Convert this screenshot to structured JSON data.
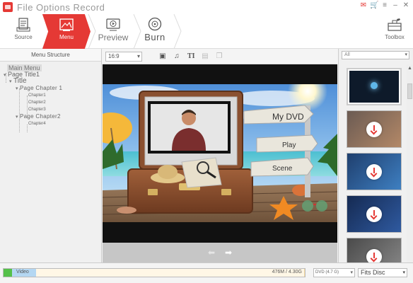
{
  "window": {
    "title": "File Options Record"
  },
  "steps": {
    "source": "Source",
    "menu": "Menu",
    "preview": "Preview",
    "burn": "Burn",
    "toolbox": "Toolbox"
  },
  "menu_structure": {
    "header": "Menu Structure",
    "tree": {
      "main_menu": "Main Menu",
      "page_title": "Page Title1",
      "title": "Title",
      "chapter_page1": "Page Chapter 1",
      "chapters1": [
        "Chapter1",
        "Chapter2",
        "Chapter3"
      ],
      "chapter_page2": "Page Chapter2",
      "chapters2": [
        "Chapter4"
      ]
    }
  },
  "center": {
    "aspect_ratio": "16:9",
    "preview_menu": {
      "title": "My DVD",
      "play": "Play",
      "scene": "Scene"
    }
  },
  "templates": {
    "filter": "All",
    "count": 5
  },
  "footer": {
    "video_label": "Video",
    "used_size": "476M / 4.30G",
    "disc_type": "DVD (4.7 G)",
    "fit_mode": "Fits Disc"
  },
  "colors": {
    "accent": "#e53935",
    "capacity_used": "#55c04a",
    "capacity_video": "#b4d7f2"
  }
}
